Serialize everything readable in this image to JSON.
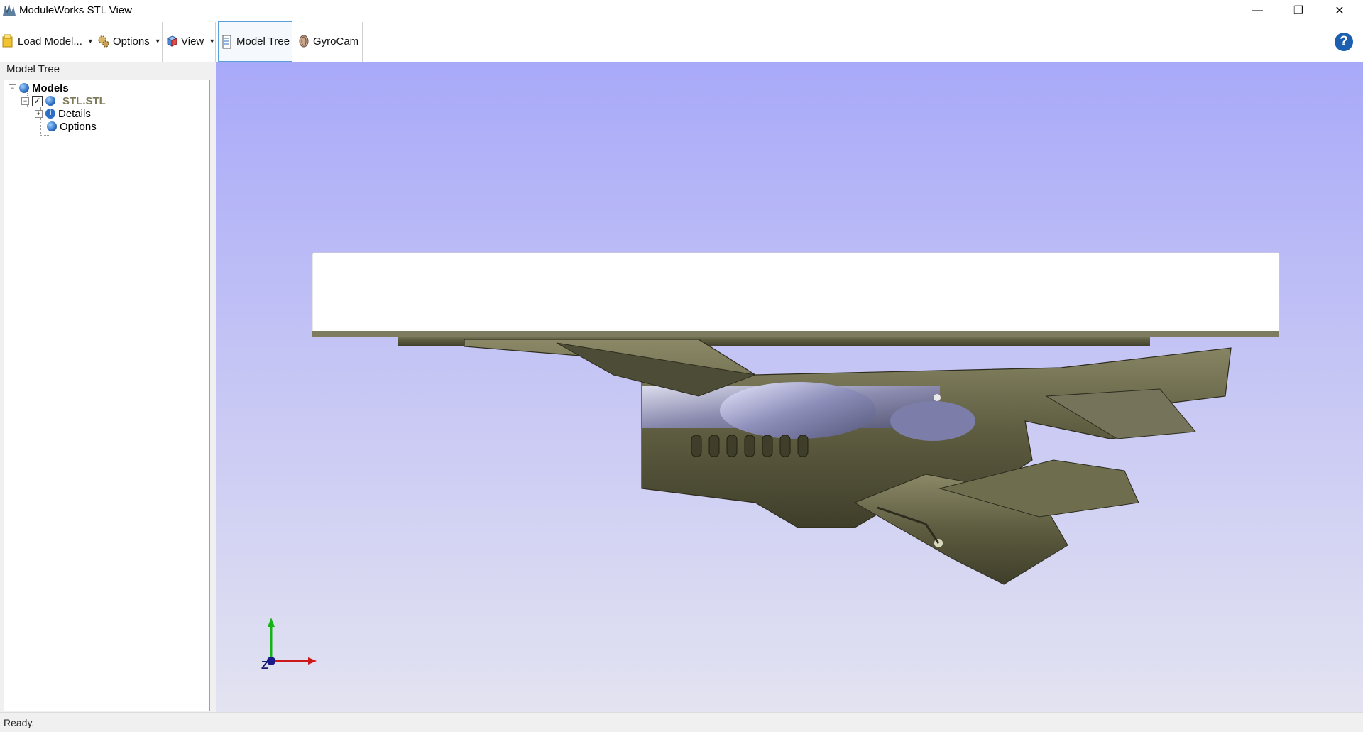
{
  "window": {
    "title": "ModuleWorks STL View",
    "controls": {
      "minimize": "—",
      "restore": "❐",
      "close": "✕"
    }
  },
  "toolbar": {
    "load_model": "Load Model...",
    "options": "Options",
    "view": "View",
    "model_tree": "Model Tree",
    "gyrocam": "GyroCam",
    "help": "?"
  },
  "panel": {
    "title": "Model Tree",
    "tree": {
      "root": "Models",
      "model_file": "STL.STL",
      "details": "Details",
      "options": "Options"
    }
  },
  "viewport": {
    "axis_z_label": "Z",
    "model": "3D STL model (turbine/engine assembly mounted under a white plate)",
    "colors": {
      "bg_top": "#a8a9f9",
      "bg_bottom": "#e3e3f1",
      "model": "#6b6a4c",
      "plate": "#ffffff"
    }
  },
  "status": {
    "text": "Ready."
  }
}
